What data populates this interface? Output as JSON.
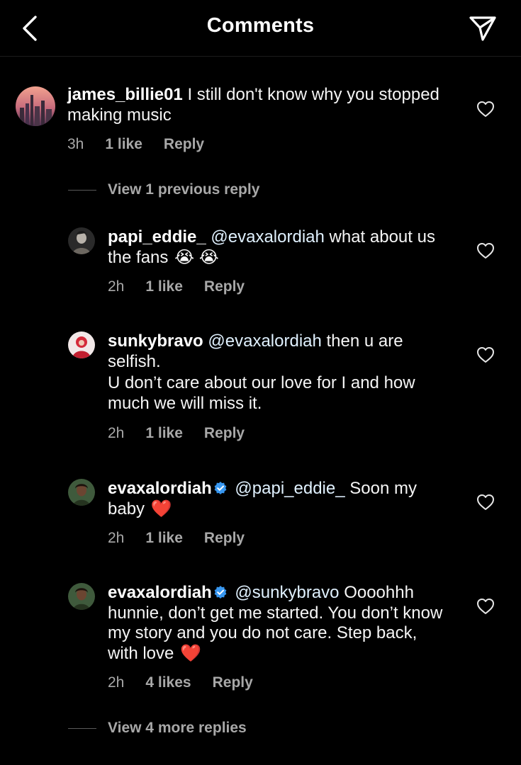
{
  "header": {
    "title": "Comments",
    "back_icon": "chevron-left-icon",
    "send_icon": "paper-plane-icon"
  },
  "colors": {
    "background": "#000000",
    "secondary_text": "#a8a8a8",
    "mention": "#e0f1ff",
    "verified_badge": "#3897f0",
    "heart_emoji": "#e0245e"
  },
  "comments": [
    {
      "username": "james_billie01",
      "text": "I still don't know why you stopped making music",
      "time": "3h",
      "likes": "1 like",
      "reply_label": "Reply"
    },
    {
      "username": "papi_eddie_",
      "mention": "@evaxalordiah",
      "text": "what about us the fans",
      "emoji": "😭 😭",
      "time": "2h",
      "likes": "1 like",
      "reply_label": "Reply"
    },
    {
      "username": "sunkybravo",
      "mention": "@evaxalordiah",
      "text": "then u are selfish.",
      "text2": "U don’t care about our love for I and how much we will miss it.",
      "time": "2h",
      "likes": "1 like",
      "reply_label": "Reply"
    },
    {
      "username": "evaxalordiah",
      "verified": true,
      "mention": "@papi_eddie_",
      "text": "Soon my baby",
      "emoji": "❤️",
      "time": "2h",
      "likes": "1 like",
      "reply_label": "Reply"
    },
    {
      "username": "evaxalordiah",
      "verified": true,
      "mention": "@sunkybravo",
      "text": "Oooohhh hunnie, don’t get me started. You don’t know my story and you do not care. Step back, with love",
      "emoji": "❤️",
      "time": "2h",
      "likes": "4 likes",
      "reply_label": "Reply"
    }
  ],
  "view_previous": "View 1 previous reply",
  "view_more": "View 4 more replies"
}
